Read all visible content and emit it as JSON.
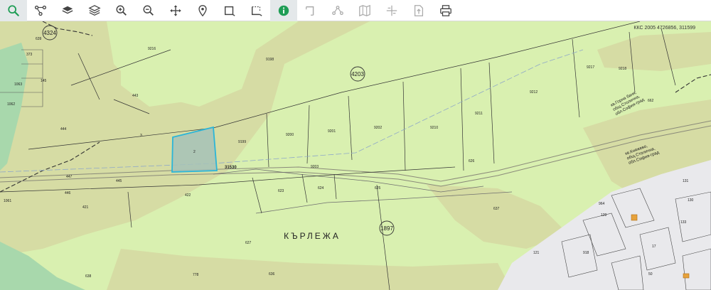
{
  "toolbar": {
    "tools": [
      {
        "icon": "search-icon",
        "active": true
      },
      {
        "icon": "connect-nodes-icon"
      },
      {
        "icon": "layers-stack-icon"
      },
      {
        "icon": "layers-outline-icon"
      },
      {
        "icon": "zoom-in-icon"
      },
      {
        "icon": "zoom-out-icon"
      },
      {
        "icon": "pan-move-icon"
      },
      {
        "icon": "location-pin-icon"
      },
      {
        "icon": "select-rectangle-icon"
      },
      {
        "icon": "select-rectangle-alt-icon"
      },
      {
        "icon": "info-icon",
        "active": true
      },
      {
        "icon": "measure-icon"
      },
      {
        "icon": "polygon-nodes-icon"
      },
      {
        "icon": "map-icon"
      },
      {
        "icon": "cross-section-icon"
      },
      {
        "icon": "export-file-icon"
      },
      {
        "icon": "print-icon"
      }
    ]
  },
  "map": {
    "coordinate_readout": "ККС 2005 4726856, 311599",
    "locality_name": "КЪРЛЕЖА",
    "circle_labels": [
      "4324",
      "4203",
      "1897"
    ],
    "district_labels": {
      "gorna_banya": [
        "кв.Горна баня,",
        "общ.Столична,",
        "обл.София-град"
      ],
      "knyazhevo": [
        "кв.Княжево,",
        "общ.Столична,",
        "обл.София-град"
      ]
    },
    "parcel_numbers": [
      "9216",
      "9198",
      "9217",
      "9218",
      "9212",
      "9211",
      "9210",
      "9202",
      "9201",
      "9200",
      "9199",
      "9203",
      "443",
      "444",
      "445",
      "446",
      "447",
      "421",
      "422",
      "623",
      "624",
      "625",
      "626",
      "627",
      "636",
      "662",
      "637",
      "638",
      "639",
      "373",
      "145",
      "1063",
      "1062",
      "1061",
      "121",
      "918",
      "17",
      "50",
      "964",
      "129",
      "130",
      "131",
      "133",
      "778",
      "3",
      "2",
      "1"
    ],
    "selected_parcel": "2",
    "point_label": "31530",
    "colors": {
      "light_green": "#d9f0b0",
      "olive": "#d6dca4",
      "dark_green": "#a8d8ac",
      "urban_gray": "#e9e9ec",
      "selection": "#2bb5d8",
      "accent": "#1f9d55"
    }
  }
}
